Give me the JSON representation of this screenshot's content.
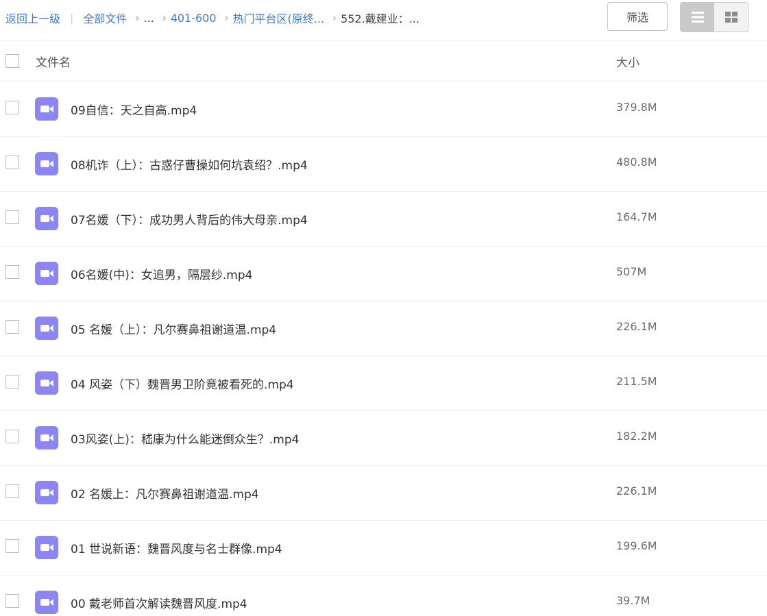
{
  "breadcrumb": {
    "back": "返回上一级",
    "all_files": "全部文件",
    "ellipsis": "...",
    "level1": "401-600",
    "level2": "热门平台区(原终...",
    "current": "552.戴建业：..."
  },
  "toolbar": {
    "filter_label": "筛选",
    "list_view_icon": "list-icon",
    "grid_view_icon": "grid-icon"
  },
  "table": {
    "col_name": "文件名",
    "col_size": "大小",
    "rows": [
      {
        "name": "09自信：天之自高.mp4",
        "size": "379.8M"
      },
      {
        "name": "08机诈（上）：古惑仔曹操如何坑袁绍？.mp4",
        "size": "480.8M"
      },
      {
        "name": "07名媛（下）：成功男人背后的伟大母亲.mp4",
        "size": "164.7M"
      },
      {
        "name": "06名媛(中)：女追男，隔层纱.mp4",
        "size": "507M"
      },
      {
        "name": "05 名媛（上）：凡尔赛鼻祖谢道温.mp4",
        "size": "226.1M"
      },
      {
        "name": "04 风姿（下）魏晋男卫阶竟被看死的.mp4",
        "size": "211.5M"
      },
      {
        "name": "03风姿(上)：嵇康为什么能迷倒众生？.mp4",
        "size": "182.2M"
      },
      {
        "name": "02 名媛上：凡尔赛鼻祖谢道温.mp4",
        "size": "226.1M"
      },
      {
        "name": "01 世说新语：魏晋风度与名士群像.mp4",
        "size": "199.6M"
      },
      {
        "name": "00 戴老师首次解读魏晋风度.mp4",
        "size": "39.7M"
      }
    ]
  },
  "colors": {
    "link": "#3b7ae0",
    "video_icon": "#8b86f4"
  }
}
